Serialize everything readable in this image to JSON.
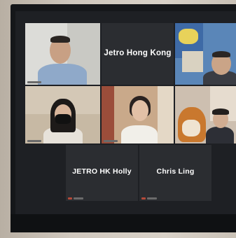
{
  "meeting": {
    "participants": [
      {
        "name": ""
      },
      {
        "name": "Jetro Hong Kong"
      },
      {
        "name": ""
      },
      {
        "name": ""
      },
      {
        "name": ""
      },
      {
        "name": ""
      },
      {
        "name": "JETRO HK Holly"
      },
      {
        "name": "Chris Ling"
      }
    ]
  },
  "colors": {
    "tile_dark": "#2b2d31",
    "screen_bg": "#1e2024",
    "monitor_frame": "#15171a"
  },
  "icons": [
    "person-silhouette",
    "dog"
  ]
}
